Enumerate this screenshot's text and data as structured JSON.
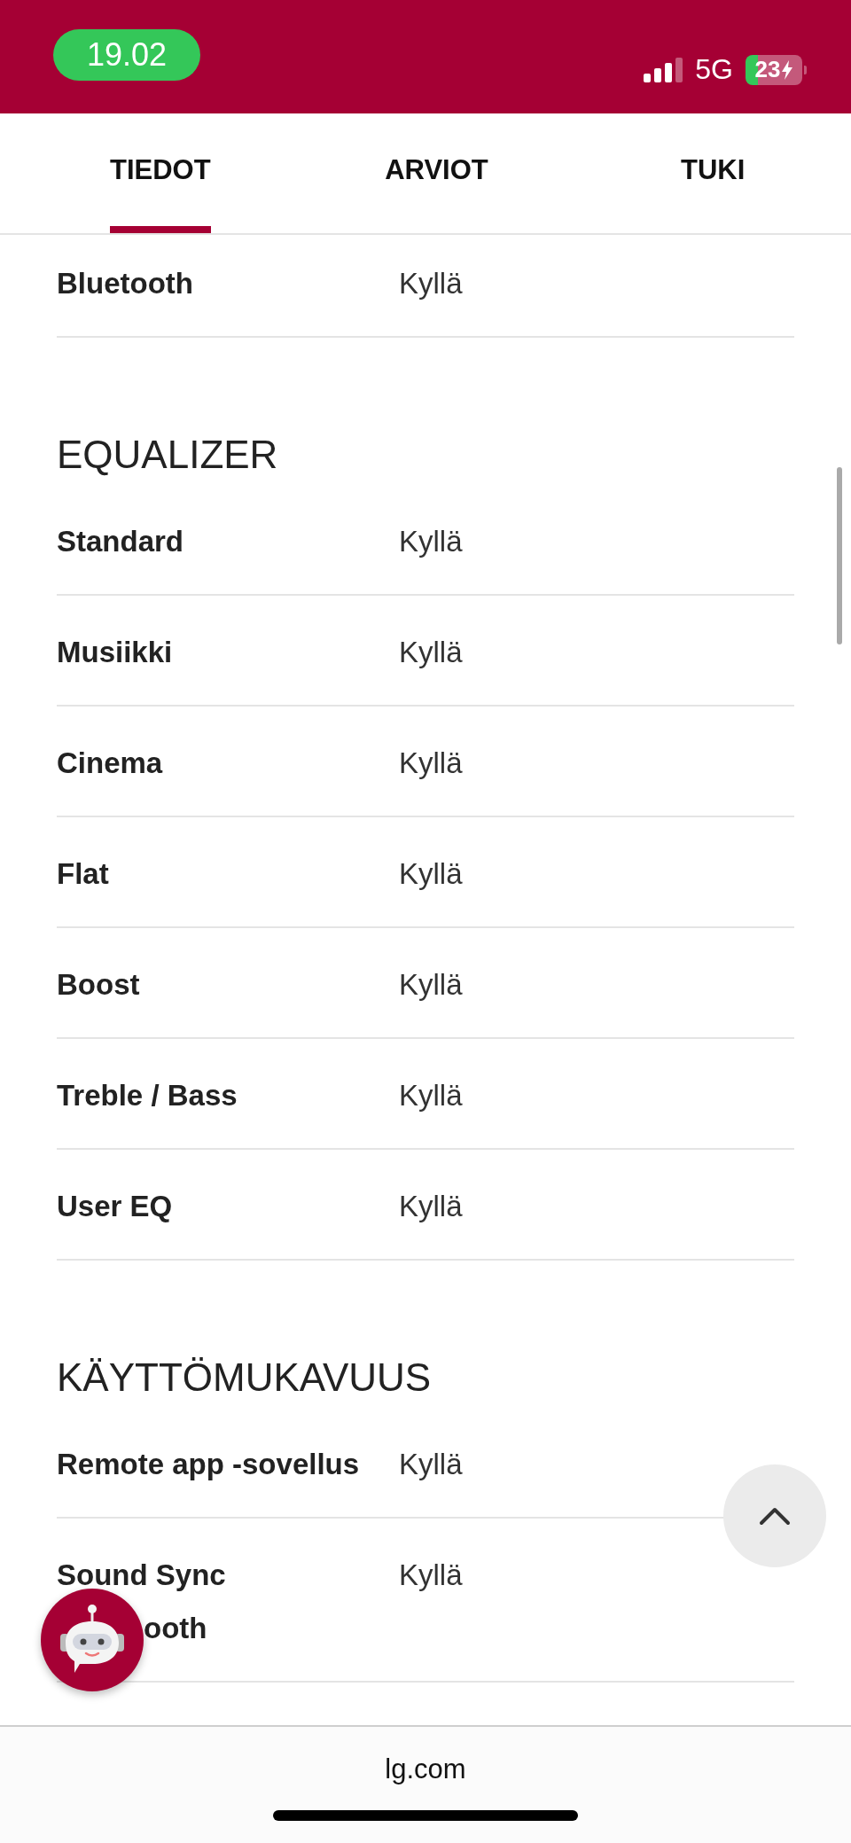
{
  "status_bar": {
    "time": "19.02",
    "network": "5G",
    "battery": "23",
    "charging": true
  },
  "tabs": [
    {
      "label": "TIEDOT",
      "selected": true
    },
    {
      "label": "ARVIOT",
      "selected": false
    },
    {
      "label": "TUKI",
      "selected": false
    }
  ],
  "sections": [
    {
      "rows": [
        {
          "label": "Bluetooth",
          "value": "Kyllä"
        }
      ]
    },
    {
      "heading": "EQUALIZER",
      "rows": [
        {
          "label": "Standard",
          "value": "Kyllä"
        },
        {
          "label": "Musiikki",
          "value": "Kyllä"
        },
        {
          "label": "Cinema",
          "value": "Kyllä"
        },
        {
          "label": "Flat",
          "value": "Kyllä"
        },
        {
          "label": "Boost",
          "value": "Kyllä"
        },
        {
          "label": "Treble / Bass",
          "value": "Kyllä"
        },
        {
          "label": "User EQ",
          "value": "Kyllä"
        }
      ]
    },
    {
      "heading": "KÄYTTÖMUKAVUUS",
      "rows": [
        {
          "label": "Remote app -sovellus",
          "value": "Kyllä"
        },
        {
          "label": "Sound Sync",
          "label_line_2": "ooth",
          "value": "Kyllä"
        }
      ]
    }
  ],
  "address_bar": {
    "url": "lg.com"
  }
}
